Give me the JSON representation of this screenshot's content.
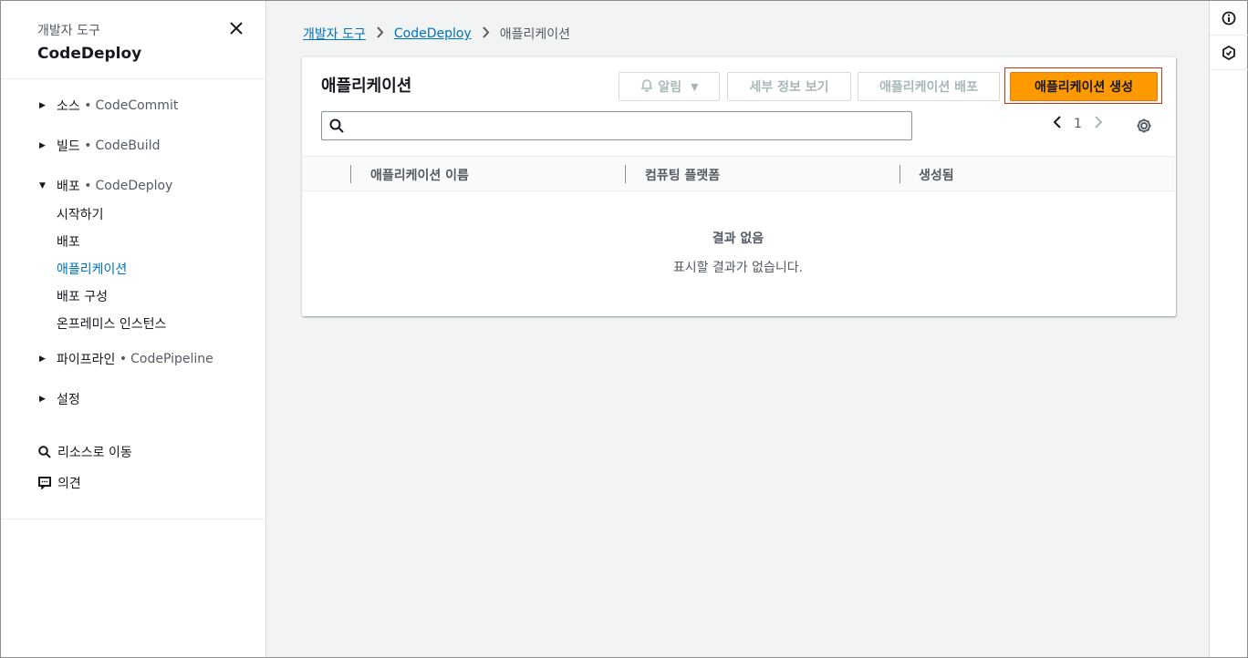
{
  "sidebar": {
    "subtitle": "개발자 도구",
    "title": "CodeDeploy",
    "sections": [
      {
        "label": "소스",
        "service": "CodeCommit"
      },
      {
        "label": "빌드",
        "service": "CodeBuild"
      },
      {
        "label": "배포",
        "service": "CodeDeploy"
      },
      {
        "label": "파이프라인",
        "service": "CodePipeline"
      },
      {
        "label": "설정",
        "service": ""
      }
    ],
    "deploy_items": [
      "시작하기",
      "배포",
      "애플리케이션",
      "배포 구성",
      "온프레미스 인스턴스"
    ],
    "utils": {
      "goto": "리소스로 이동",
      "feedback": "의견"
    }
  },
  "breadcrumb": {
    "root": "개발자 도구",
    "service": "CodeDeploy",
    "current": "애플리케이션"
  },
  "card": {
    "title": "애플리케이션",
    "buttons": {
      "alert": "알림",
      "detail": "세부 정보 보기",
      "deploy": "애플리케이션 배포",
      "create": "애플리케이션 생성"
    },
    "pager": {
      "page": "1"
    },
    "columns": [
      "애플리케이션 이름",
      "컴퓨팅 플랫폼",
      "생성됨"
    ],
    "empty": {
      "title": "결과 없음",
      "message": "표시할 결과가 없습니다."
    }
  },
  "colors": {
    "accent": "#ff9900",
    "link": "#0073bb"
  }
}
